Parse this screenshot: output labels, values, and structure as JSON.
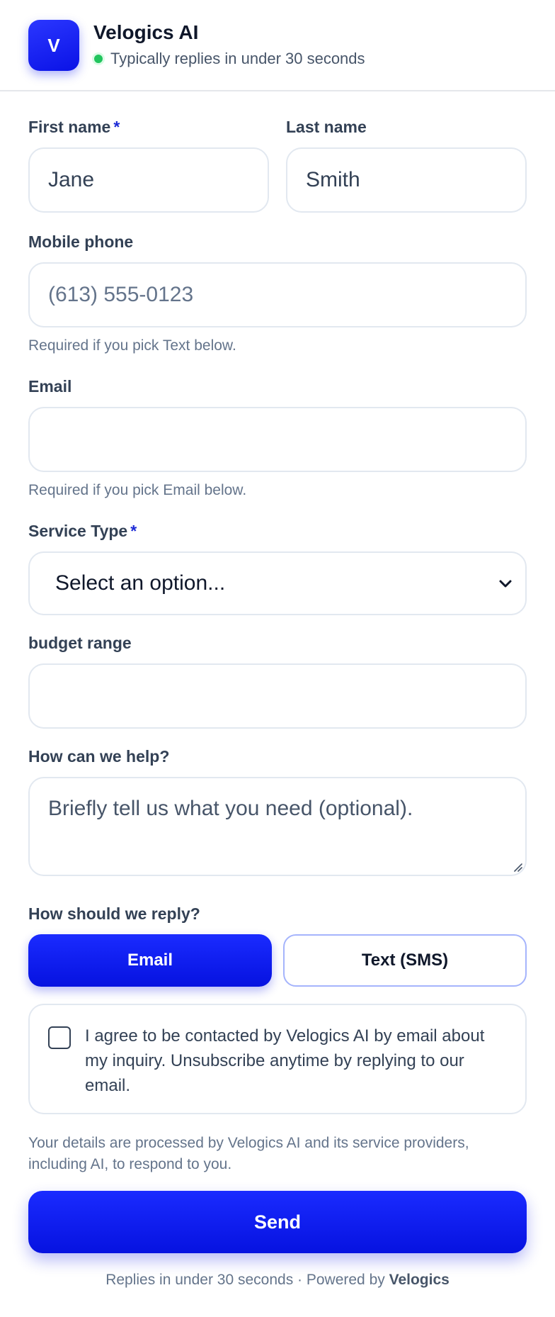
{
  "header": {
    "avatar_letter": "V",
    "brand": "Velogics AI",
    "status": "Typically replies in under 30 seconds",
    "status_color": "#22c55e"
  },
  "form": {
    "first_name": {
      "label": "First name",
      "required_mark": "*",
      "value": "Jane"
    },
    "last_name": {
      "label": "Last name",
      "value": "Smith"
    },
    "mobile_phone": {
      "label": "Mobile phone",
      "placeholder": "(613) 555-0123",
      "help": "Required if you pick Text below."
    },
    "email": {
      "label": "Email",
      "value": "",
      "help": "Required if you pick Email below."
    },
    "service_type": {
      "label": "Service Type",
      "required_mark": "*",
      "selected": "Select an option..."
    },
    "budget_range": {
      "label": "budget range",
      "value": ""
    },
    "help_text": {
      "label": "How can we help?",
      "placeholder": "Briefly tell us what you need (optional)."
    },
    "reply": {
      "label": "How should we reply?",
      "options": [
        "Email",
        "Text (SMS)"
      ],
      "selected": "Email"
    },
    "consent": "I agree to be contacted by Velogics AI by email about my inquiry. Unsubscribe anytime by replying to our email.",
    "privacy": "Your details are processed by Velogics AI and its service providers, including AI, to respond to you.",
    "send_label": "Send"
  },
  "footer": {
    "text": "Replies in under 30 seconds · Powered by",
    "brand": "Velogics"
  },
  "colors": {
    "accent": "#0a12e6"
  }
}
